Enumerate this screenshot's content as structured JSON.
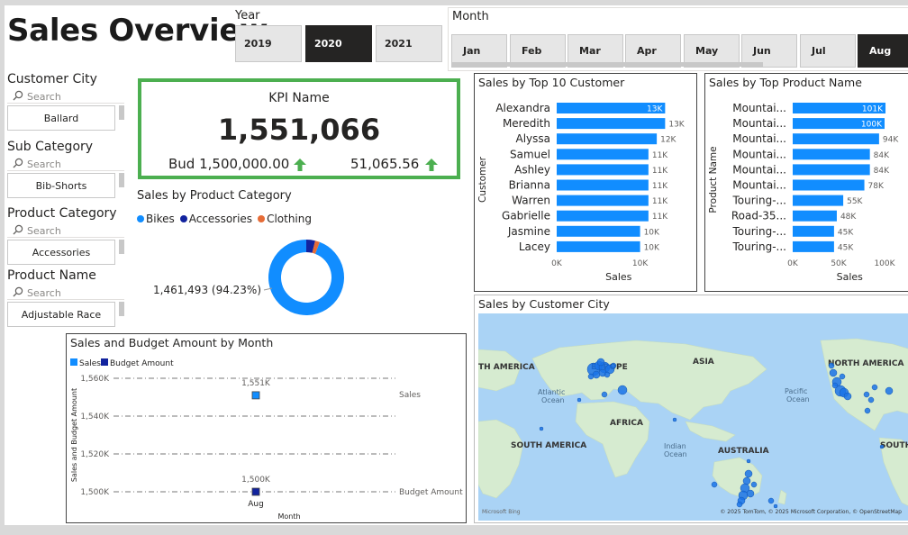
{
  "page": {
    "title": "Sales Overview"
  },
  "year_slicer": {
    "label": "Year",
    "options": [
      "2019",
      "2020",
      "2021"
    ],
    "selected": "2020"
  },
  "month_slicer": {
    "label": "Month",
    "options": [
      "Jan",
      "Feb",
      "Mar",
      "Apr",
      "May",
      "Jun",
      "Jul",
      "Aug"
    ],
    "selected": "Aug"
  },
  "filters": [
    {
      "label": "Customer City",
      "search_placeholder": "Search",
      "value": "Ballard"
    },
    {
      "label": "Sub Category",
      "search_placeholder": "Search",
      "value": "Bib-Shorts"
    },
    {
      "label": "Product Category",
      "search_placeholder": "Search",
      "value": "Accessories"
    },
    {
      "label": "Product Name",
      "search_placeholder": "Search",
      "value": "Adjustable Race"
    }
  ],
  "kpi": {
    "title": "KPI Name",
    "value": "1,551,066",
    "budget": "Bud 1,500,000.00",
    "variance": "51,065.56",
    "border_color": "#4caf50",
    "arrow_color": "#4caf50"
  },
  "colors": {
    "primary": "#118dff",
    "dark_blue": "#12239e",
    "orange": "#e66c37"
  },
  "donut": {
    "title": "Sales by Product Category",
    "legend": [
      {
        "name": "Bikes",
        "color": "#118dff"
      },
      {
        "name": "Accessories",
        "color": "#12239e"
      },
      {
        "name": "Clothing",
        "color": "#e66c37"
      }
    ],
    "label": "1,461,493 (94.23%)"
  },
  "top_customers_chart": {
    "title": "Sales by Top 10 Customer",
    "ylabel": "Customer",
    "xlabel": "Sales",
    "ticks": [
      "0K",
      "10K"
    ]
  },
  "top_products_chart": {
    "title": "Sales by Top Product Name",
    "ylabel": "Product Name",
    "xlabel": "Sales",
    "ticks": [
      "0K",
      "50K",
      "100K"
    ]
  },
  "budget_chart": {
    "title": "Sales and Budget Amount by Month",
    "legend": [
      {
        "name": "Sales",
        "color": "#118dff"
      },
      {
        "name": "Budget Amount",
        "color": "#12239e"
      }
    ],
    "ylabel": "Sales and Budget Amount",
    "xlabel": "Month",
    "yticks": [
      "1,560K",
      "1,540K",
      "1,520K",
      "1,500K"
    ],
    "xtick": "Aug",
    "sales_label": "1,551K",
    "budget_label": "1,500K",
    "series_labels": [
      "Sales",
      "Budget Amount"
    ]
  },
  "map": {
    "title": "Sales by Customer City",
    "labels": [
      "TH AMERICA",
      "EUROPE",
      "ASIA",
      "NORTH AMERICA",
      "Atlantic",
      "Ocean",
      "Pacific",
      "Ocean",
      "AFRICA",
      "SOUTH AMERICA",
      "Indian",
      "Ocean",
      "AUSTRALIA",
      "SOUTH"
    ],
    "attribution": "© 2025 TomTom, © 2025 Microsoft Corporation, © OpenStreetMap",
    "bing": "Microsoft Bing"
  },
  "chart_data": [
    {
      "type": "bar",
      "title": "Sales by Top 10 Customer",
      "xlabel": "Sales",
      "ylabel": "Customer",
      "categories": [
        "Alexandra",
        "Meredith",
        "Alyssa",
        "Samuel",
        "Ashley",
        "Brianna",
        "Warren",
        "Gabrielle",
        "Jasmine",
        "Lacey"
      ],
      "values": [
        13000,
        13000,
        12000,
        11000,
        11000,
        11000,
        11000,
        11000,
        10000,
        10000
      ],
      "data_labels": [
        "13K",
        "13K",
        "12K",
        "11K",
        "11K",
        "11K",
        "11K",
        "11K",
        "10K",
        "10K"
      ],
      "xlim": [
        0,
        13500
      ]
    },
    {
      "type": "bar",
      "title": "Sales by Top Product Name",
      "xlabel": "Sales",
      "ylabel": "Product Name",
      "categories": [
        "Mountai...",
        "Mountai...",
        "Mountai...",
        "Mountai...",
        "Mountai...",
        "Mountai...",
        "Touring-...",
        "Road-35...",
        "Touring-...",
        "Touring-..."
      ],
      "values": [
        101000,
        100000,
        94000,
        84000,
        84000,
        78000,
        55000,
        48000,
        45000,
        45000
      ],
      "data_labels": [
        "101K",
        "100K",
        "94K",
        "84K",
        "84K",
        "78K",
        "55K",
        "48K",
        "45K",
        "45K"
      ],
      "xlim": [
        0,
        100000
      ]
    },
    {
      "type": "pie",
      "title": "Sales by Product Category",
      "categories": [
        "Bikes",
        "Accessories",
        "Clothing"
      ],
      "values": [
        94.23,
        3.8,
        1.97
      ],
      "data_labels": [
        "1,461,493 (94.23%)"
      ]
    },
    {
      "type": "scatter",
      "title": "Sales and Budget Amount by Month",
      "categories": [
        "Aug"
      ],
      "series": [
        {
          "name": "Sales",
          "values": [
            1551000
          ]
        },
        {
          "name": "Budget Amount",
          "values": [
            1500000
          ]
        }
      ],
      "ylim": [
        1500000,
        1560000
      ]
    }
  ]
}
